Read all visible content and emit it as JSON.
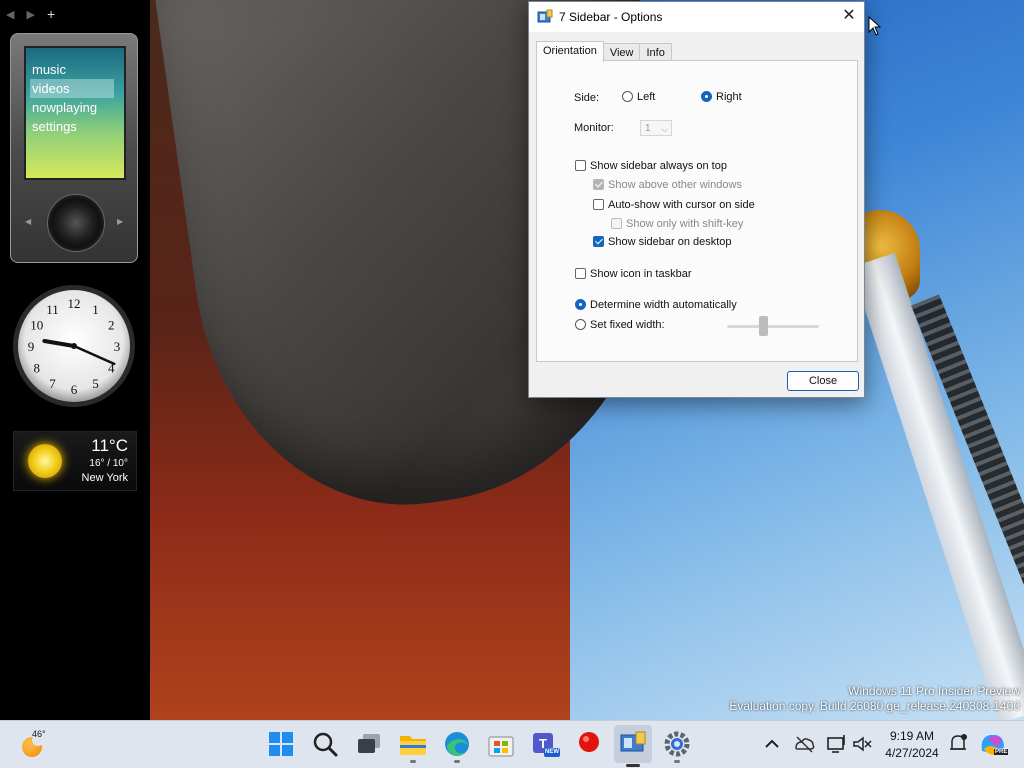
{
  "window": {
    "title": "7 Sidebar - Options",
    "close_glyph": "✕",
    "tabs": [
      "Orientation",
      "View",
      "Info"
    ],
    "active_tab": "Orientation"
  },
  "orientation": {
    "side_label": "Side:",
    "side_options": [
      {
        "label": "Left",
        "checked": false
      },
      {
        "label": "Right",
        "checked": true
      }
    ],
    "monitor_label": "Monitor:",
    "monitor_value": "1",
    "checkboxes": [
      {
        "label": "Show sidebar always on top",
        "checked": false,
        "enabled": true
      },
      {
        "label": "Show above other windows",
        "checked": true,
        "enabled": false
      },
      {
        "label": "Auto-show with cursor on side",
        "checked": false,
        "enabled": true
      },
      {
        "label": "Show only with shift-key",
        "checked": false,
        "enabled": false
      },
      {
        "label": "Show sidebar on desktop",
        "checked": true,
        "enabled": true
      },
      {
        "label": "Show icon in taskbar",
        "checked": false,
        "enabled": true
      }
    ],
    "width_options": [
      {
        "label": "Determine width automatically",
        "checked": true
      },
      {
        "label": "Set fixed width:",
        "checked": false
      }
    ],
    "fixed_width_slider": 0.4
  },
  "buttons": {
    "close": "Close"
  },
  "sidebar": {
    "nav_back": "◀",
    "nav_forward": "▶",
    "nav_add": "+",
    "zune_menu": [
      "music",
      "videos",
      "nowplaying",
      "settings"
    ],
    "zune_active": "videos",
    "clock_numbers": [
      "12",
      "1",
      "2",
      "3",
      "4",
      "5",
      "6",
      "7",
      "8",
      "9",
      "10",
      "11"
    ],
    "clock_time": {
      "hour": 9,
      "minute": 19
    },
    "weather": {
      "temp": "11°C",
      "range": "16° / 10°",
      "city": "New York"
    }
  },
  "watermark": {
    "line1": "Windows 11 Pro Insider Preview",
    "line2": "Evaluation copy. Build 26080.ge_release.240308-1400"
  },
  "taskbar": {
    "weather_temp": "46°",
    "apps": [
      "start-icon",
      "search-icon",
      "task-view-icon",
      "file-explorer-icon",
      "edge-icon",
      "store-icon",
      "teams-icon",
      "record-icon",
      "sidebar-app-icon",
      "settings-icon"
    ],
    "teams_badge": "NEW",
    "copilot_badge": "PRE",
    "time": "9:19 AM",
    "date": "4/27/2024"
  },
  "colors": {
    "accent": "#1565c0",
    "dialog_bg": "#f0f0f0",
    "taskbar_bg": "#dfe5ee"
  }
}
